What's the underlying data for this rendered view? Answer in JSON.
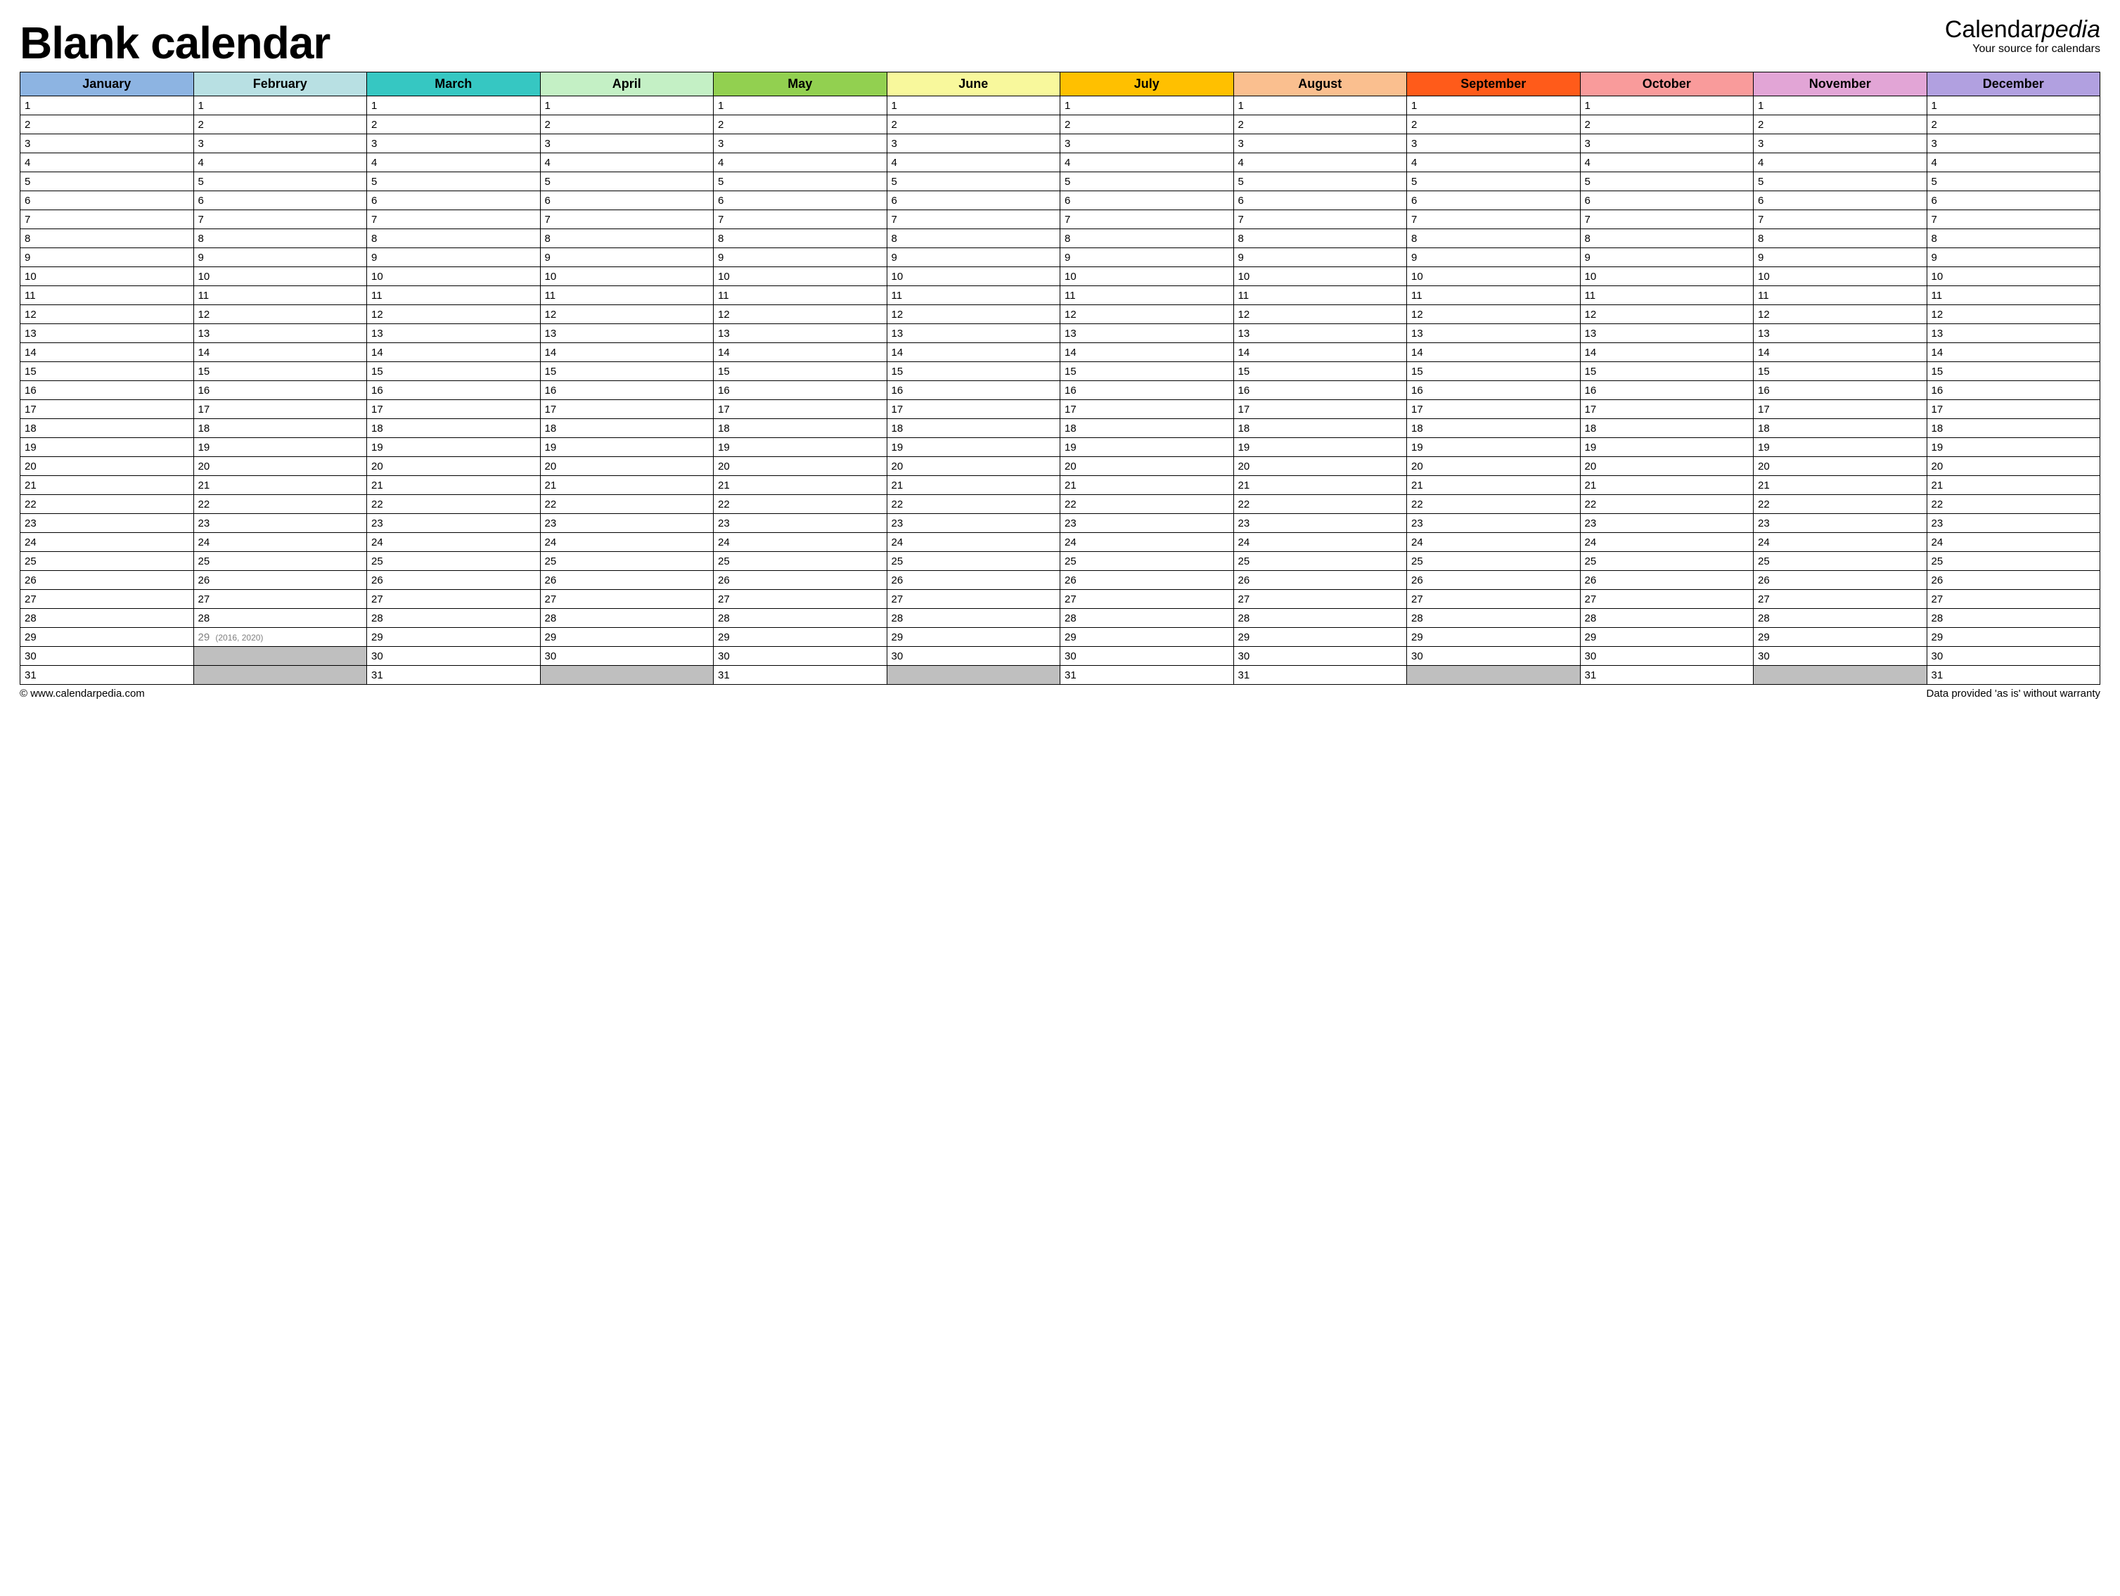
{
  "title": "Blank calendar",
  "brand": {
    "prefix": "Calendar",
    "emph": "pedia",
    "sub": "Your source for calendars"
  },
  "months": [
    {
      "name": "January",
      "color": "#8db4e2",
      "days": 31
    },
    {
      "name": "February",
      "color": "#b8e0e3",
      "days": 29,
      "leap_day": 29,
      "leap_note": "(2016, 2020)"
    },
    {
      "name": "March",
      "color": "#36c7c2",
      "days": 31
    },
    {
      "name": "April",
      "color": "#c4f0c5",
      "days": 30
    },
    {
      "name": "May",
      "color": "#92d050",
      "days": 31
    },
    {
      "name": "June",
      "color": "#f8f89c",
      "days": 30
    },
    {
      "name": "July",
      "color": "#ffc000",
      "days": 31
    },
    {
      "name": "August",
      "color": "#fabf8f",
      "days": 31
    },
    {
      "name": "September",
      "color": "#ff5b1a",
      "days": 30
    },
    {
      "name": "October",
      "color": "#f99b9b",
      "days": 31
    },
    {
      "name": "November",
      "color": "#e2a5d6",
      "days": 30
    },
    {
      "name": "December",
      "color": "#b1a0e0",
      "days": 31
    }
  ],
  "max_rows": 31,
  "footer": {
    "left": "© www.calendarpedia.com",
    "right": "Data provided 'as is' without warranty"
  }
}
